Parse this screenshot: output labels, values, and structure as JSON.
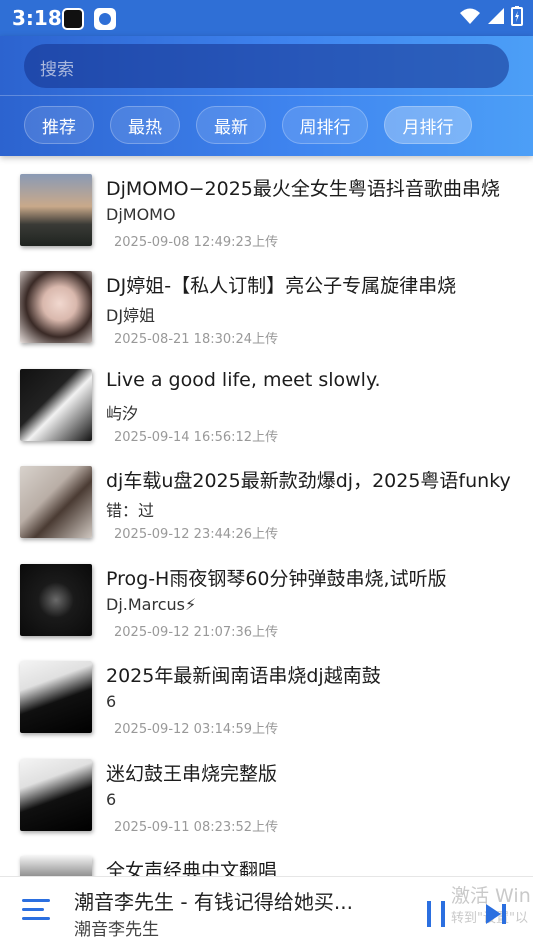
{
  "status": {
    "time": "3:18"
  },
  "search": {
    "placeholder": "搜索"
  },
  "tabs": [
    "推荐",
    "最热",
    "最新",
    "周排行",
    "月排行"
  ],
  "songs": [
    {
      "title": "DjMOMO−2025最火全女生粤语抖音歌曲串烧",
      "artist": "DjMOMO",
      "date": "2025-09-08 12:49:23上传"
    },
    {
      "title": "DJ婷姐-【私人订制】亮公子专属旋律串烧",
      "artist": "DJ婷姐",
      "date": "2025-08-21 18:30:24上传"
    },
    {
      "title": "Live a good life, meet slowly.",
      "artist": "屿汐",
      "date": "2025-09-14 16:56:12上传"
    },
    {
      "title": "dj车载u盘2025最新款劲爆dj，2025粤语funky",
      "artist": "错：过",
      "date": "2025-09-12 23:44:26上传"
    },
    {
      "title": "Prog-H雨夜钢琴60分钟弹鼓串烧,试听版",
      "artist": "Dj.Marcus⚡",
      "date": "2025-09-12 21:07:36上传"
    },
    {
      "title": "2025年最新闽南语串烧dj越南鼓",
      "artist": "6",
      "date": "2025-09-12 03:14:59上传"
    },
    {
      "title": "迷幻鼓王串烧完整版",
      "artist": "6",
      "date": "2025-09-11 08:23:52上传"
    },
    {
      "title": "全女声经典中文翻唱",
      "artist": "",
      "date": ""
    }
  ],
  "player": {
    "title": "潮音李先生 - 有钱记得给她买...",
    "artist": "潮音李先生"
  },
  "watermark": {
    "line1": "激活 Win",
    "line2": "转到\"设置\"以"
  },
  "colors": {
    "accent": "#2b6fe0",
    "header": "#3f84ef"
  }
}
